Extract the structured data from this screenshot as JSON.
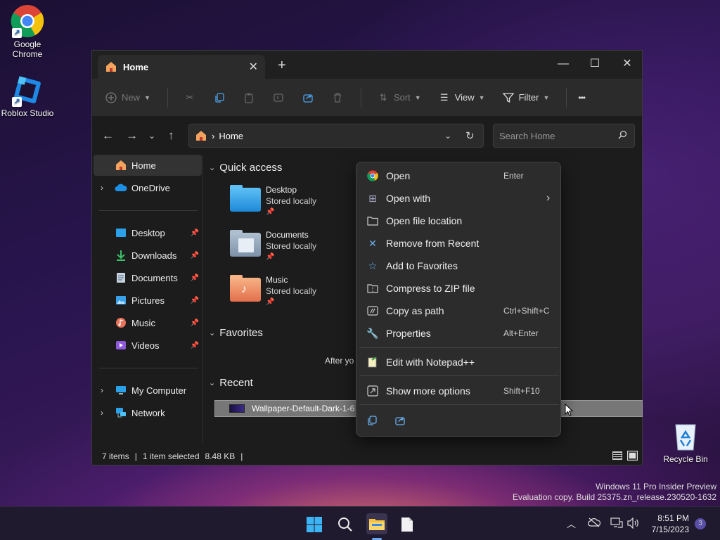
{
  "desktop": {
    "icons": [
      {
        "label_line1": "Google",
        "label_line2": "Chrome"
      },
      {
        "label_line1": "Roblox Studio"
      },
      {
        "label_line1": "Recycle Bin"
      }
    ],
    "watermark_line1": "Windows 11 Pro Insider Preview",
    "watermark_line2": "Evaluation copy. Build 25375.zn_release.230520-1632"
  },
  "explorer": {
    "tab_title": "Home",
    "tab_close": "✕",
    "new_tab": "+",
    "window_controls": {
      "minimize": "—",
      "maximize": "☐",
      "close": "✕"
    },
    "toolbar": {
      "new_label": "New",
      "sort_label": "Sort",
      "view_label": "View",
      "filter_label": "Filter",
      "more_label": "•••"
    },
    "address": {
      "path_sep": "›",
      "location": "Home",
      "refresh": "↻"
    },
    "search": {
      "placeholder": "Search Home"
    },
    "sidebar": {
      "items": [
        {
          "label": "Home"
        },
        {
          "label": "OneDrive"
        },
        {
          "label": "Desktop"
        },
        {
          "label": "Downloads"
        },
        {
          "label": "Documents"
        },
        {
          "label": "Pictures"
        },
        {
          "label": "Music"
        },
        {
          "label": "Videos"
        },
        {
          "label": "My Computer"
        },
        {
          "label": "Network"
        }
      ]
    },
    "main": {
      "quick_access_title": "Quick access",
      "favorites_title": "Favorites",
      "recent_title": "Recent",
      "favorites_text": "After yo",
      "quick_access": [
        {
          "name": "Desktop",
          "sub": "Stored locally"
        },
        {
          "name": "Documents",
          "sub": "Stored locally"
        },
        {
          "name": "Music",
          "sub": "Stored locally"
        }
      ],
      "recent_file": "Wallpaper-Default-Dark-1-6"
    },
    "status": {
      "items": "7 items",
      "sep": "|",
      "selected": "1 item selected",
      "size": "8.48 KB"
    }
  },
  "context_menu": {
    "items": [
      {
        "label": "Open",
        "shortcut": "Enter"
      },
      {
        "label": "Open with",
        "shortcut": "›"
      },
      {
        "label": "Open file location",
        "shortcut": ""
      },
      {
        "label": "Remove from Recent",
        "shortcut": ""
      },
      {
        "label": "Add to Favorites",
        "shortcut": ""
      },
      {
        "label": "Compress to ZIP file",
        "shortcut": ""
      },
      {
        "label": "Copy as path",
        "shortcut": "Ctrl+Shift+C"
      },
      {
        "label": "Properties",
        "shortcut": "Alt+Enter"
      },
      {
        "label": "Edit with Notepad++",
        "shortcut": ""
      },
      {
        "label": "Show more options",
        "shortcut": "Shift+F10"
      }
    ]
  },
  "taskbar": {
    "time": "8:51 PM",
    "date": "7/15/2023",
    "notification_count": "3"
  }
}
